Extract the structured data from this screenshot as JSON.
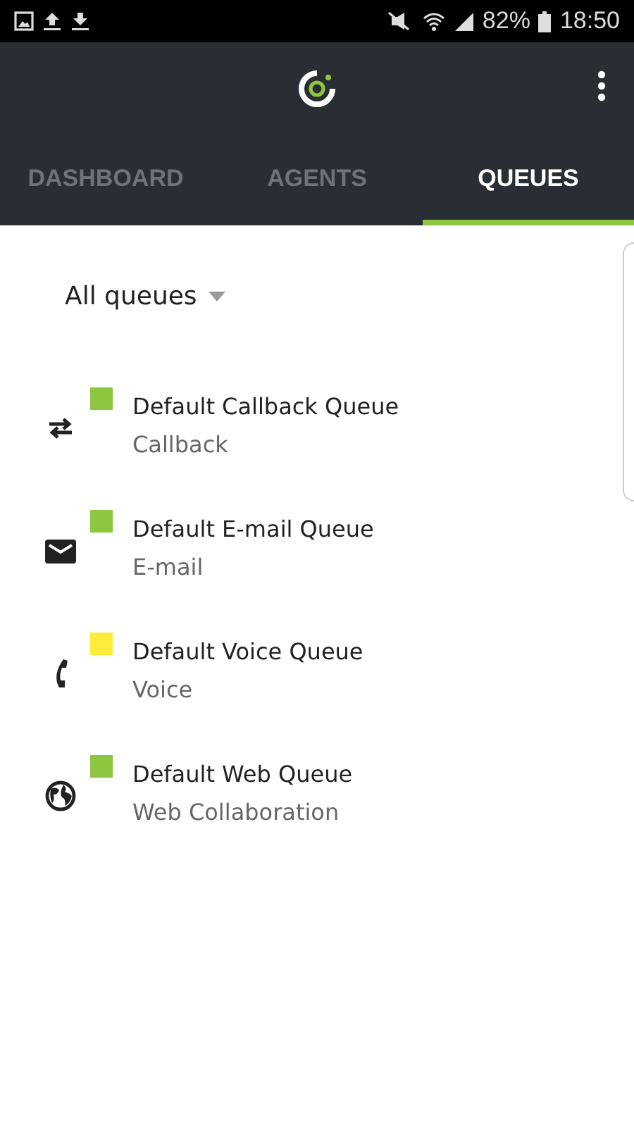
{
  "status_bar": {
    "battery": "82%",
    "time": "18:50"
  },
  "tabs": [
    {
      "label": "DASHBOARD",
      "selected": false
    },
    {
      "label": "AGENTS",
      "selected": false
    },
    {
      "label": "QUEUES",
      "selected": true
    }
  ],
  "filter": {
    "value": "All queues"
  },
  "queues": [
    {
      "kind": "callback",
      "name": "Default Callback Queue",
      "type": "Callback",
      "color": "#8dc63f"
    },
    {
      "kind": "email",
      "name": "Default E-mail Queue",
      "type": "E-mail",
      "color": "#8dc63f"
    },
    {
      "kind": "voice",
      "name": "Default Voice Queue",
      "type": "Voice",
      "color": "#ffeb3b"
    },
    {
      "kind": "web",
      "name": "Default Web Queue",
      "type": "Web Collaboration",
      "color": "#8dc63f"
    }
  ]
}
